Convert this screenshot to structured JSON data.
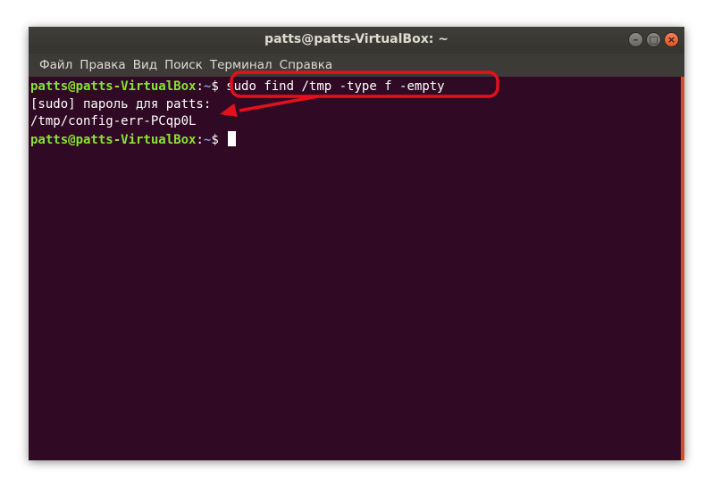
{
  "window": {
    "title": "patts@patts-VirtualBox: ~",
    "controls": {
      "minimize": "–",
      "maximize": "□",
      "close": "×"
    }
  },
  "menu": {
    "items": [
      "Файл",
      "Правка",
      "Вид",
      "Поиск",
      "Терминал",
      "Справка"
    ]
  },
  "terminal": {
    "lines": [
      {
        "user": "patts@patts-VirtualBox",
        "sep": ":",
        "path": "~",
        "prompt": "$ ",
        "command": "sudo find /tmp -type f -empty"
      },
      {
        "text": "[sudo] пароль для patts:"
      },
      {
        "text": "/tmp/config-err-PCqp0L"
      },
      {
        "user": "patts@patts-VirtualBox",
        "sep": ":",
        "path": "~",
        "prompt": "$ ",
        "command": ""
      }
    ]
  },
  "colors": {
    "terminal_bg": "#300a24",
    "prompt_user": "#8ae234",
    "prompt_path": "#729fcf",
    "annotation": "#e3101e",
    "scroll_accent": "#e95420"
  }
}
